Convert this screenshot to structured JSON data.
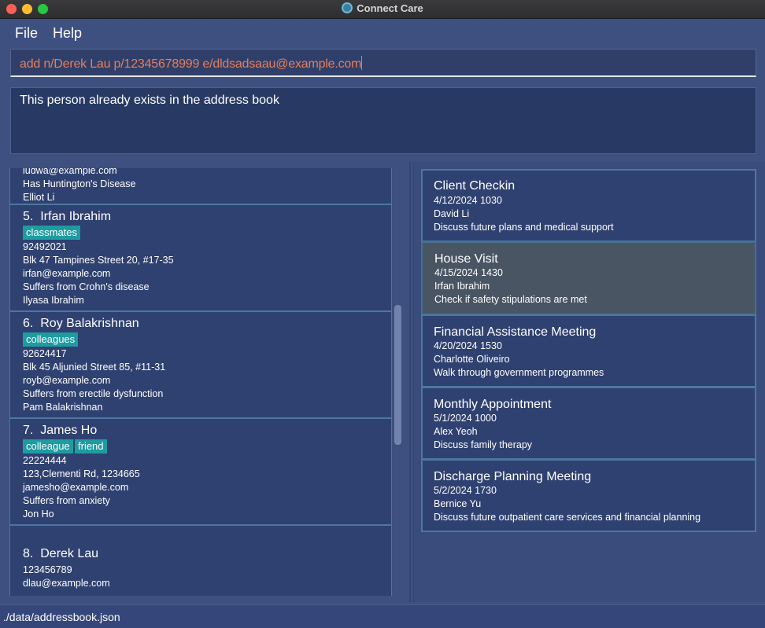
{
  "window": {
    "title": "Connect Care"
  },
  "menu": {
    "file": "File",
    "help": "Help"
  },
  "command": {
    "value": "add n/Derek Lau p/12345678999 e/dldsadsaau@example.com"
  },
  "result": {
    "message": "This person already exists in the address book"
  },
  "persons": {
    "partial": {
      "email": "iudwa@example.com",
      "condition": "Has Huntington's Disease",
      "contact": "Elliot Li"
    },
    "p5": {
      "index": "5.",
      "name": "Irfan Ibrahim",
      "tags": [
        "classmates"
      ],
      "phone": "92492021",
      "address": "Blk 47 Tampines Street 20, #17-35",
      "email": "irfan@example.com",
      "condition": "Suffers from Crohn's disease",
      "contact": "Ilyasa Ibrahim"
    },
    "p6": {
      "index": "6.",
      "name": "Roy Balakrishnan",
      "tags": [
        "colleagues"
      ],
      "phone": "92624417",
      "address": "Blk 45 Aljunied Street 85, #11-31",
      "email": "royb@example.com",
      "condition": "Suffers from erectile dysfunction",
      "contact": "Pam Balakrishnan"
    },
    "p7": {
      "index": "7.",
      "name": "James Ho",
      "tags": [
        "colleague",
        "friend"
      ],
      "phone": "22224444",
      "address": "123,Clementi Rd, 1234665",
      "email": "jamesho@example.com",
      "condition": "Suffers from anxiety",
      "contact": "Jon Ho"
    },
    "p8": {
      "index": "8.",
      "name": "Derek Lau",
      "phone": "123456789",
      "email": "dlau@example.com"
    }
  },
  "appointments": [
    {
      "title": "Client Checkin",
      "datetime": "4/12/2024 1030",
      "person": "David Li",
      "description": "Discuss future plans and medical support",
      "selected": false
    },
    {
      "title": "House Visit",
      "datetime": "4/15/2024 1430",
      "person": "Irfan Ibrahim",
      "description": "Check if safety stipulations are met",
      "selected": true
    },
    {
      "title": "Financial Assistance Meeting",
      "datetime": "4/20/2024 1530",
      "person": "Charlotte Oliveiro",
      "description": "Walk through government programmes",
      "selected": false
    },
    {
      "title": "Monthly Appointment",
      "datetime": "5/1/2024 1000",
      "person": "Alex Yeoh",
      "description": "Discuss family therapy",
      "selected": false
    },
    {
      "title": "Discharge Planning Meeting",
      "datetime": "5/2/2024 1730",
      "person": "Bernice Yu",
      "description": "Discuss future outpatient care services and financial planning",
      "selected": false
    }
  ],
  "status": {
    "path": "./data/addressbook.json"
  },
  "colors": {
    "background": "#3e5080",
    "command_text": "#e67e5b",
    "tag": "#1e9ca0",
    "card_border": "#4c77a0",
    "selected_card": "#4a5563"
  }
}
